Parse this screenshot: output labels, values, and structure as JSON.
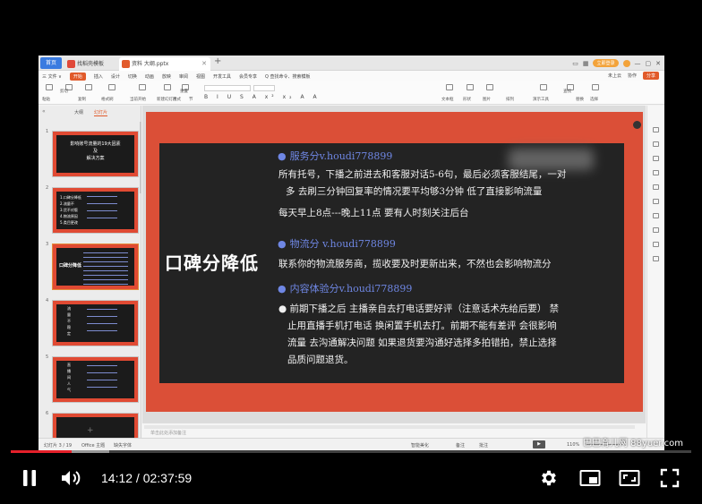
{
  "app": {
    "home_tab": "首页",
    "tabs": [
      {
        "label": "找稻壳模板",
        "icon_color": "#e0493a"
      },
      {
        "label": "资料 大纲.pptx",
        "icon_color": "#e25b2c"
      }
    ],
    "login_label": "立即登录",
    "menu": [
      "三 文件 ∨",
      "开始",
      "插入",
      "设计",
      "切换",
      "动画",
      "放映",
      "审阅",
      "视图",
      "开发工具",
      "会员专享",
      "Q 查找命令、搜索模板"
    ],
    "menu_active_index": 1,
    "menu_right": [
      "未上云",
      "协作",
      "分享"
    ],
    "ribbon_labels": [
      "粘贴",
      "剪切",
      "复制",
      "格式刷",
      "当前开始",
      "新建幻灯片",
      "版式",
      "节",
      "重置",
      "文本框",
      "形状",
      "图片",
      "排列",
      "演示工具",
      "查找",
      "替换",
      "选择"
    ],
    "font_format_row": "B I U S A x² x₂ A A"
  },
  "left_panel": {
    "tabs": [
      "大纲",
      "幻灯片"
    ],
    "active_tab": 1,
    "slides": [
      {
        "num": "1",
        "lines": [
          "影响账号流量的19大因素",
          "及",
          "解决方案"
        ]
      },
      {
        "num": "2",
        "lines": [
          "1.口碑分降低",
          "2.流量不",
          "3.货不对版",
          "4.物流原因",
          "5.类目更改"
        ]
      },
      {
        "num": "3",
        "lines": [
          "口碑分降低"
        ]
      },
      {
        "num": "4",
        "lines": [
          "流",
          "量",
          "不",
          "稳",
          "定"
        ]
      },
      {
        "num": "5",
        "lines": [
          "直",
          "播",
          "间",
          "人",
          "气"
        ]
      },
      {
        "num": "6",
        "lines": []
      }
    ],
    "selected_index": 2
  },
  "slide": {
    "title": "口碑分降低",
    "sections": [
      {
        "heading": "服务分v.houdi778899",
        "body": [
          "所有托号，下播之前进去和客服对话5-6句，最后必须客服结尾，一对",
          "多 去刷三分钟回复率的情况要平均够3分钟 低了直接影响流量",
          "每天早上8点---晚上11点 要有人时刻关注后台"
        ]
      },
      {
        "heading": "物流分 v.houdi778899",
        "body": [
          "联系你的物流服务商，揽收要及时更新出来，不然也会影响物流分"
        ]
      },
      {
        "heading": "内容体验分v.houdi778899",
        "body": [
          "● 前期下播之后 主播亲自去打电话要好评（注意话术先给后要） 禁",
          "止用直播手机打电话 换闲置手机去打。前期不能有差评 会很影响",
          "流量 去沟通解决问题 如果退货要沟通好选择多拍错拍，禁止选择",
          "品质问题退货。"
        ]
      }
    ]
  },
  "notes_placeholder": "单击此处添加备注",
  "status": {
    "slide_count": "幻灯片 3 / 19",
    "theme": "Office 主题",
    "missing_font": "缺失字体",
    "beautify": "智能美化",
    "notes": "备注",
    "comments": "批注",
    "zoom": "110%"
  },
  "watermark": "巴巴育儿网 88yuer.com",
  "player": {
    "current_time": "14:12",
    "duration": "02:37:59",
    "played_fraction": 0.0895,
    "buffered_fraction": 0.145,
    "progress_color": "#e5202a"
  }
}
